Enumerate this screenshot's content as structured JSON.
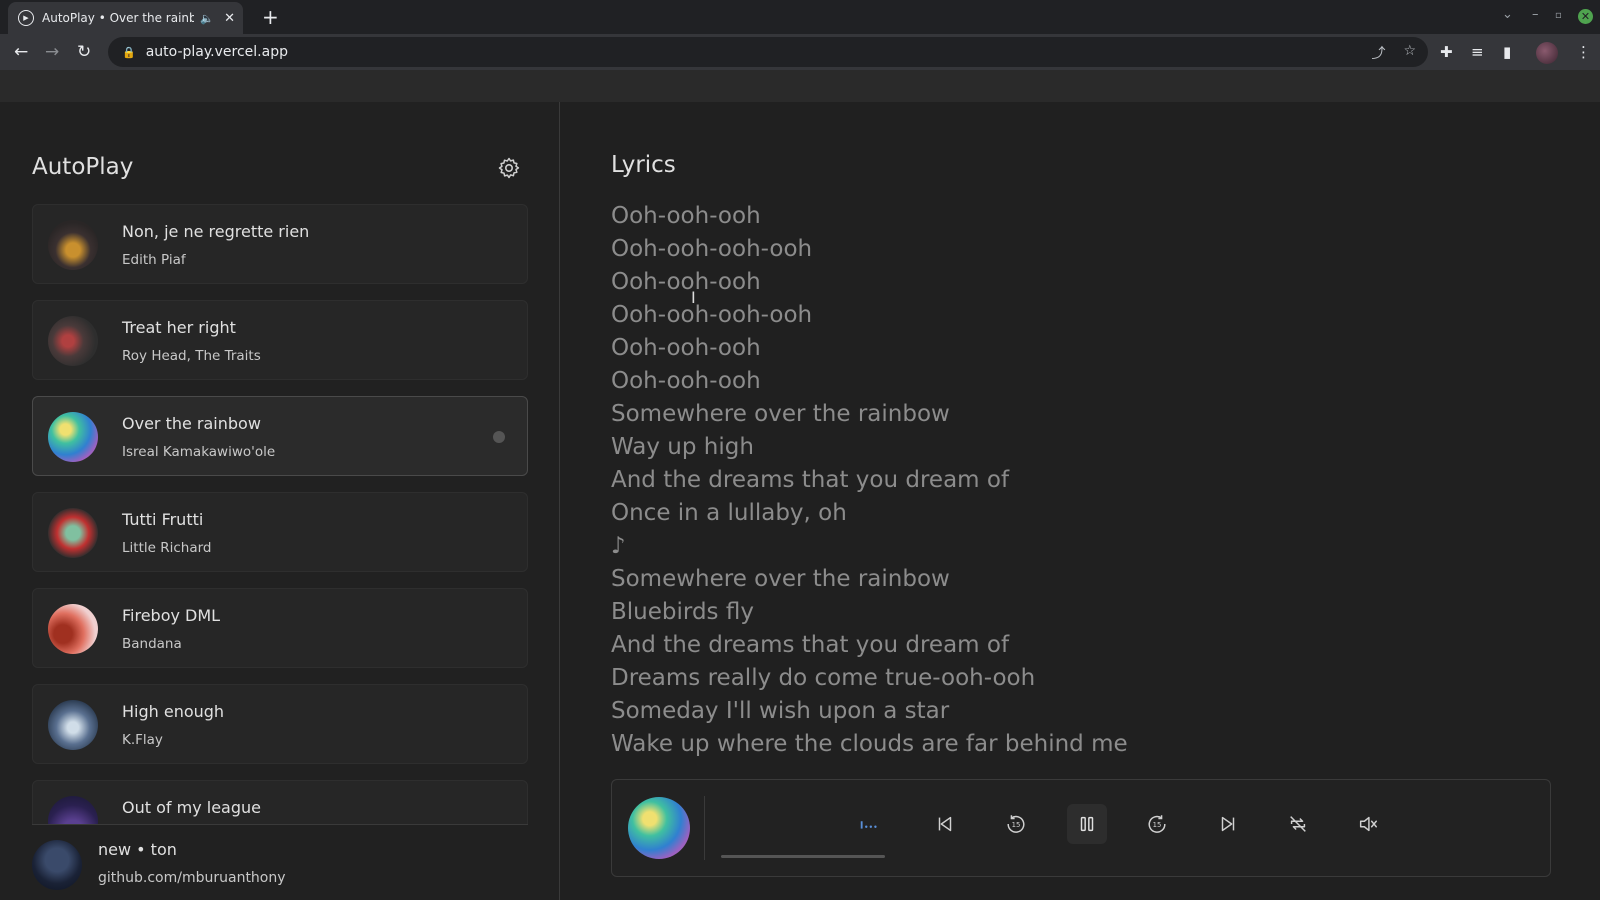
{
  "browser": {
    "tab_title": "AutoPlay • Over the rainb",
    "tab_audio_icon": "speaker-icon",
    "url": "auto-play.vercel.app"
  },
  "sidebar": {
    "title": "AutoPlay",
    "songs": [
      {
        "name": "Non, je ne regrette rien",
        "artist": "Edith Piaf",
        "art": "#7a5a2a"
      },
      {
        "name": "Treat her right",
        "artist": "Roy Head, The Traits",
        "art": "#5a3a3a"
      },
      {
        "name": "Over the rainbow",
        "artist": "Isreal Kamakawiwo'ole",
        "art": "#3fb0c0",
        "active": true
      },
      {
        "name": "Tutti Frutti",
        "artist": "Little Richard",
        "art": "#c0392b"
      },
      {
        "name": "Fireboy DML",
        "artist": "Bandana",
        "art": "#e0706a"
      },
      {
        "name": "High enough",
        "artist": "K.Flay",
        "art": "#5a7090"
      },
      {
        "name": "Out of my league",
        "artist": "",
        "art": "#3a2a60"
      }
    ],
    "user": {
      "name": "new • ton",
      "link": "github.com/mburuanthony"
    }
  },
  "main": {
    "lyrics_title": "Lyrics",
    "lyrics": [
      "Ooh-ooh-ooh",
      "Ooh-ooh-ooh-ooh",
      "Ooh-ooh-ooh",
      "Ooh-ooh-ooh-ooh",
      "Ooh-ooh-ooh",
      "Ooh-ooh-ooh",
      "Somewhere over the rainbow",
      "Way up high",
      "And the dreams that you dream of",
      "Once in a lullaby, oh",
      "♪",
      "Somewhere over the rainbow",
      "Bluebirds fly",
      "And the dreams that you dream of",
      "Dreams really do come true-ooh-ooh",
      "Someday I'll wish upon a star",
      "Wake up where the clouds are far behind me"
    ]
  },
  "colors": {
    "accent": "#5a8fd8",
    "background": "#202020"
  }
}
